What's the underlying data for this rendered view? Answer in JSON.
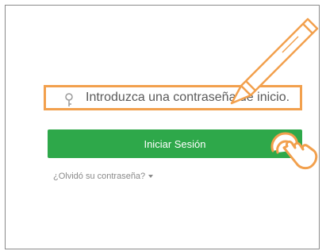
{
  "login": {
    "password_field": {
      "placeholder": "Introduzca una contraseña de inicio.",
      "icon": "key-icon"
    },
    "signin_button": {
      "label": "Iniciar Sesión",
      "color": "#2ea84a"
    },
    "forgot_link": {
      "label": "¿Olvidó su contraseña?",
      "icon": "chevron-down-icon"
    }
  },
  "annotations": {
    "highlight_color": "#f2a04d",
    "pencil": "pencil-icon",
    "tap": "hand-tap-icon"
  }
}
